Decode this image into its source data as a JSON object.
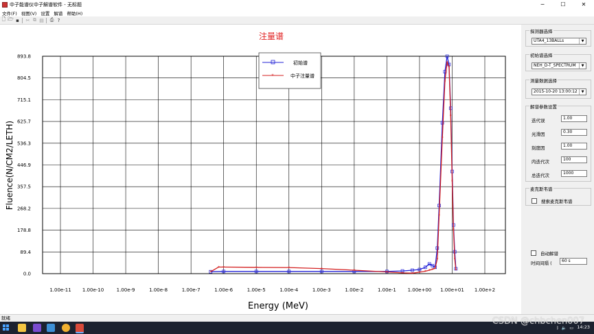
{
  "window": {
    "title": "中子能谱仪中子解谱软件 - 无标题",
    "controls": [
      "─",
      "☐",
      "✕"
    ]
  },
  "menu": [
    "文件(F)",
    "视图(V)",
    "设置",
    "解谱",
    "帮助(H)"
  ],
  "toolbar_icons": [
    "new-icon",
    "open-icon",
    "save-icon",
    "cut-icon",
    "copy-icon",
    "paste-icon",
    "print-icon",
    "help-icon"
  ],
  "chart_data": {
    "type": "line",
    "title": "注量谱",
    "xlabel": "Energy (MeV)",
    "ylabel": "Fluence(N/CM2/LETH)",
    "x_scale": "log",
    "xlim": [
      1e-11,
      100
    ],
    "ylim": [
      0,
      893.8
    ],
    "x_ticks": [
      "1.00e-11",
      "1.00e-10",
      "1.00e-9",
      "1.00e-8",
      "1.00e-7",
      "1.00e-6",
      "1.00e-5",
      "1.00e-4",
      "1.00e-3",
      "1.00e-2",
      "1.00e-1",
      "1.00e+00",
      "1.00e+01",
      "1.00e+2"
    ],
    "y_ticks": [
      "893.8",
      "804.5",
      "715.1",
      "625.7",
      "536.3",
      "446.9",
      "357.5",
      "268.2",
      "178.8",
      "89.4",
      "0.0"
    ],
    "grid": true,
    "legend": "top-left",
    "series": [
      {
        "name": "初始谱",
        "color": "#1f1fd6",
        "marker": "square",
        "points": [
          [
            4e-07,
            8
          ],
          [
            1e-06,
            9
          ],
          [
            1e-05,
            9
          ],
          [
            0.0001,
            9
          ],
          [
            0.001,
            9
          ],
          [
            0.01,
            9
          ],
          [
            0.1,
            9
          ],
          [
            0.3,
            11
          ],
          [
            0.6,
            14
          ],
          [
            1,
            17
          ],
          [
            1.5,
            26
          ],
          [
            2,
            40
          ],
          [
            2.5,
            33
          ],
          [
            3,
            26
          ],
          [
            3.5,
            105
          ],
          [
            4,
            280
          ],
          [
            5,
            620
          ],
          [
            6,
            830
          ],
          [
            7,
            893.8
          ],
          [
            8,
            860
          ],
          [
            9,
            680
          ],
          [
            10,
            420
          ],
          [
            11,
            200
          ],
          [
            12,
            90
          ],
          [
            13,
            20
          ]
        ]
      },
      {
        "name": "中子注量谱",
        "color": "#d42020",
        "marker": "star",
        "points": [
          [
            4e-07,
            8
          ],
          [
            7e-07,
            27
          ],
          [
            1e-06,
            27
          ],
          [
            1e-05,
            26
          ],
          [
            0.0001,
            25
          ],
          [
            0.001,
            21
          ],
          [
            0.01,
            14
          ],
          [
            0.1,
            7
          ],
          [
            0.3,
            3
          ],
          [
            0.6,
            2
          ],
          [
            1,
            6
          ],
          [
            1.5,
            10
          ],
          [
            2,
            14
          ],
          [
            2.5,
            18
          ],
          [
            3,
            22
          ],
          [
            3.5,
            60
          ],
          [
            4,
            240
          ],
          [
            5,
            560
          ],
          [
            6,
            790
          ],
          [
            7,
            870
          ],
          [
            8,
            850
          ],
          [
            9,
            650
          ],
          [
            10,
            380
          ],
          [
            11,
            180
          ],
          [
            12,
            60
          ],
          [
            13,
            15
          ]
        ]
      }
    ]
  },
  "side": {
    "detector": {
      "title": "探测器选择",
      "value": "UTA4_13BALLs"
    },
    "initial": {
      "title": "初始谱选择",
      "value": "NEH_D-T_SPECTRUM"
    },
    "measure": {
      "title": "测量数据选择",
      "value": "2015-10-20 13:00:12"
    },
    "params": {
      "title": "解谱参数设置",
      "rows": [
        {
          "label": "迭代误",
          "value": "1.00"
        },
        {
          "label": "光滑因",
          "value": "0.30"
        },
        {
          "label": "刻度因",
          "value": "1.00"
        },
        {
          "label": "内迭代次",
          "value": "100"
        },
        {
          "label": "总迭代次",
          "value": "1000"
        }
      ]
    },
    "maxed": {
      "title": "麦克斯韦谱",
      "checkbox": "搜索麦克斯韦谱"
    },
    "auto": {
      "checkbox": "自动解谱",
      "interval_label": "时间间隔 (",
      "interval_value": "60 s"
    }
  },
  "status": "就绪",
  "taskbar": {
    "time": "14:23",
    "watermark": "CSDN @chbchen007"
  }
}
